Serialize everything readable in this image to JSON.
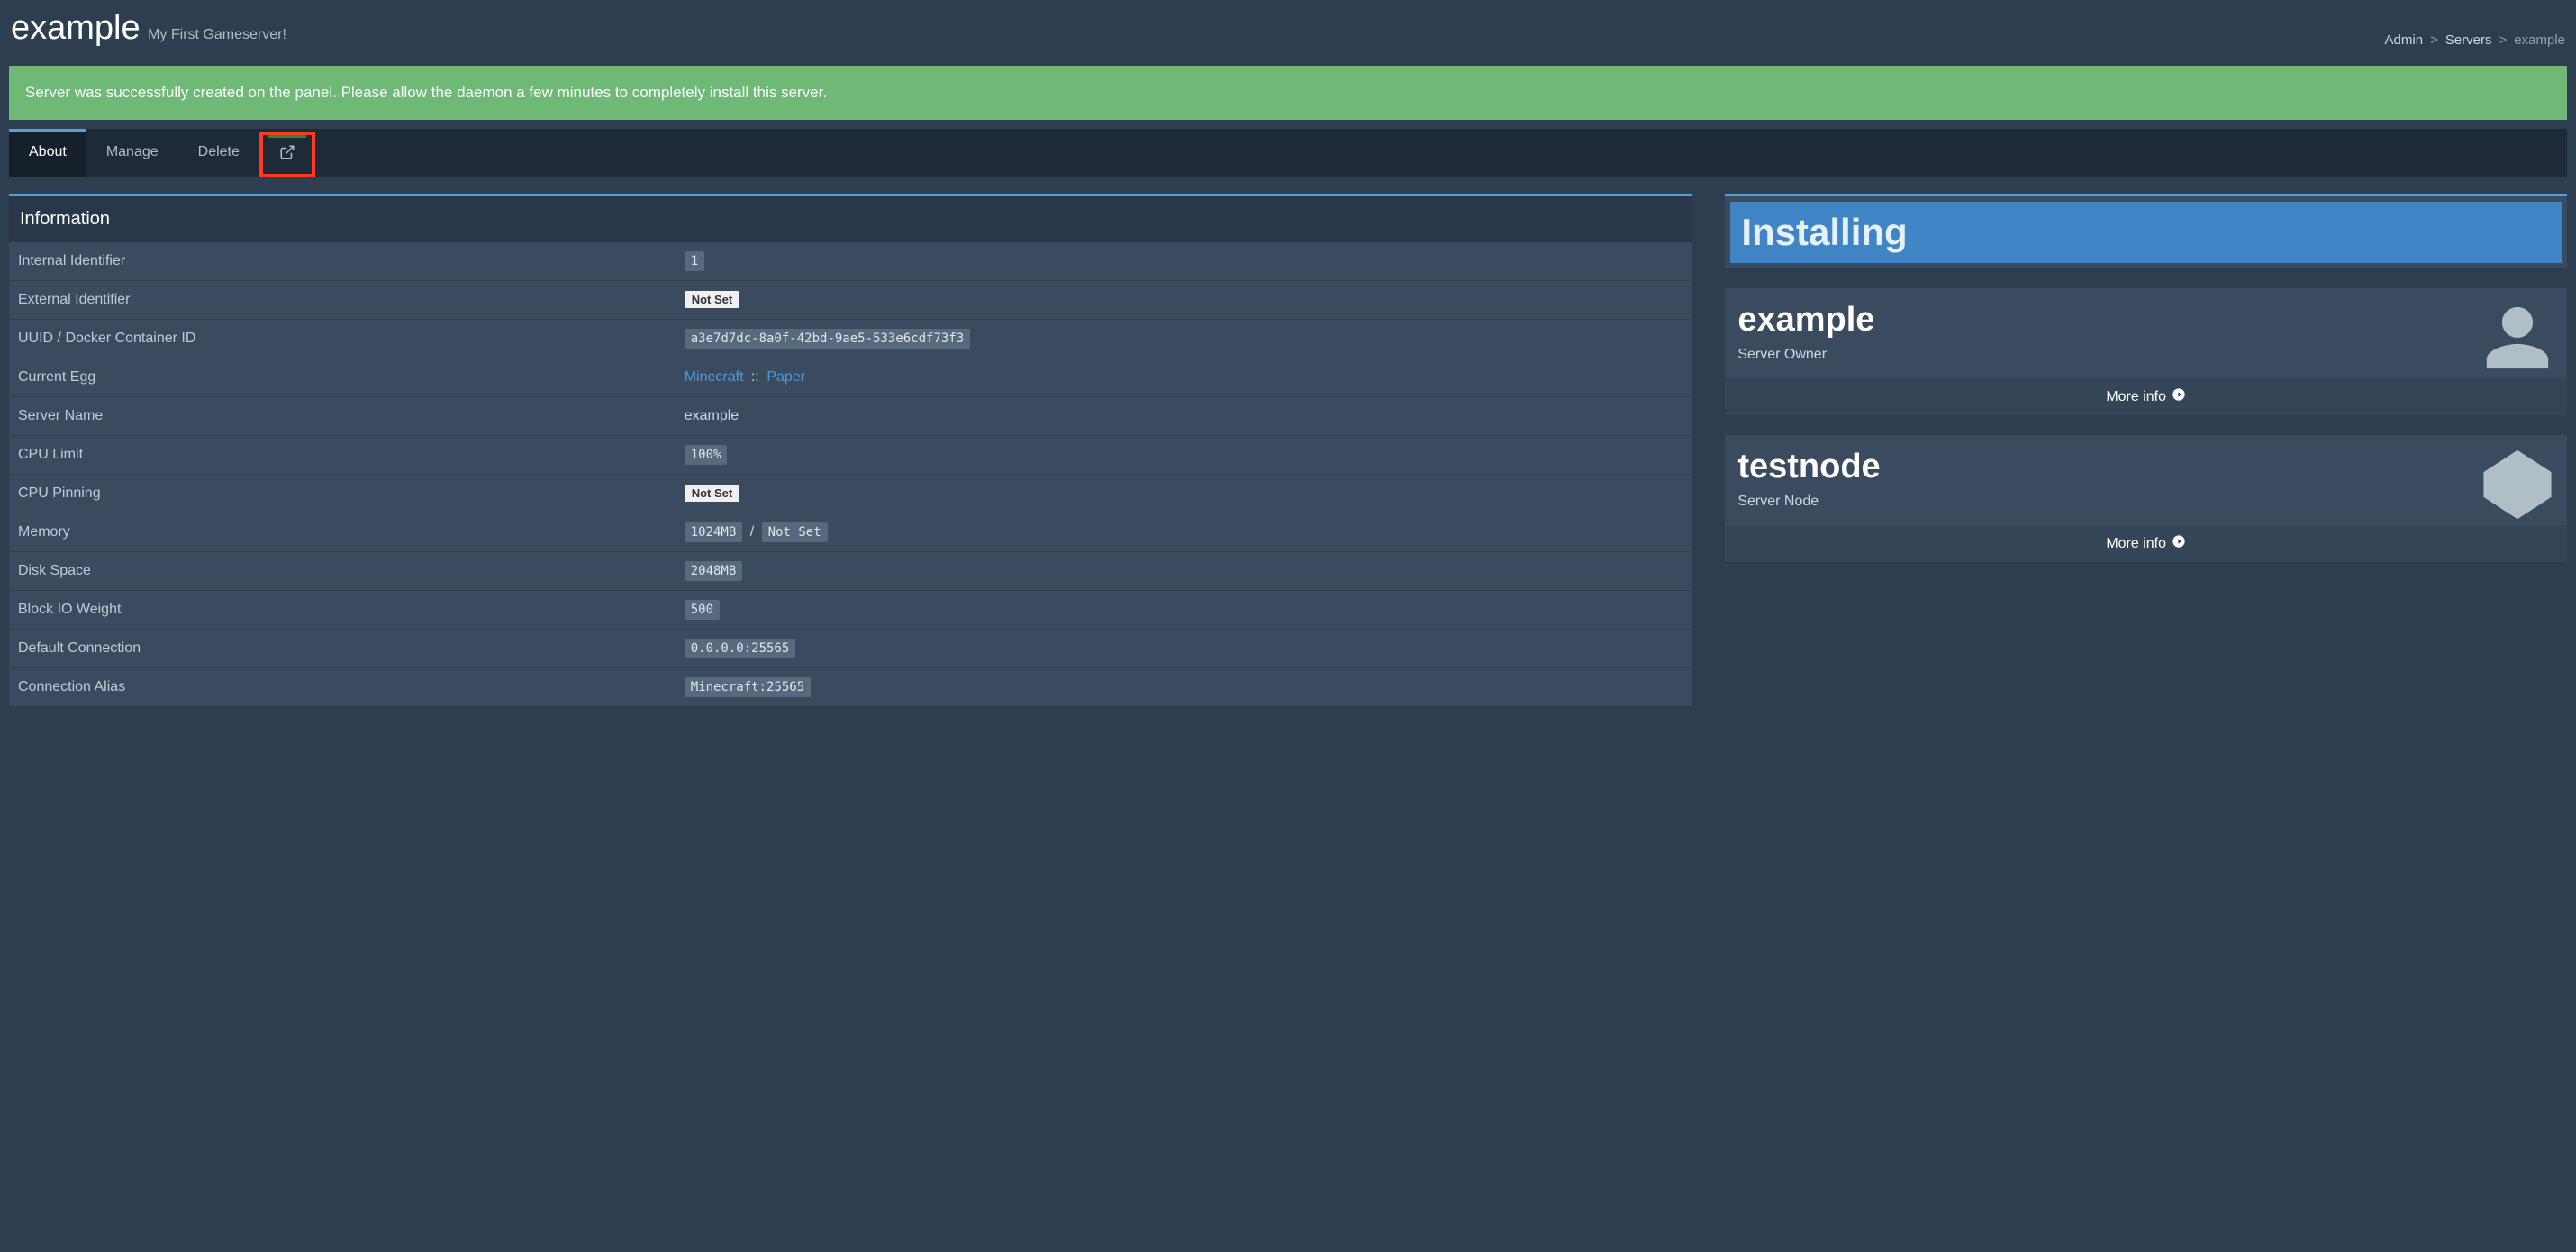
{
  "header": {
    "title": "example",
    "subtitle": "My First Gameserver!"
  },
  "breadcrumb": {
    "admin": "Admin",
    "servers": "Servers",
    "current": "example"
  },
  "alert": "Server was successfully created on the panel. Please allow the daemon a few minutes to completely install this server.",
  "tabs": {
    "about": "About",
    "manage": "Manage",
    "delete": "Delete"
  },
  "info": {
    "heading": "Information",
    "rows": {
      "internal_id": {
        "label": "Internal Identifier",
        "value": "1"
      },
      "external_id": {
        "label": "External Identifier",
        "value": "Not Set"
      },
      "uuid": {
        "label": "UUID / Docker Container ID",
        "value": "a3e7d7dc-8a0f-42bd-9ae5-533e6cdf73f3"
      },
      "egg": {
        "label": "Current Egg",
        "nest": "Minecraft",
        "egg": "Paper",
        "sep": "::"
      },
      "name": {
        "label": "Server Name",
        "value": "example"
      },
      "cpu_limit": {
        "label": "CPU Limit",
        "value": "100%"
      },
      "cpu_pinning": {
        "label": "CPU Pinning",
        "value": "Not Set"
      },
      "memory": {
        "label": "Memory",
        "value": "1024MB",
        "swap": "Not Set",
        "slash": "/"
      },
      "disk": {
        "label": "Disk Space",
        "value": "2048MB"
      },
      "block_io": {
        "label": "Block IO Weight",
        "value": "500"
      },
      "default_conn": {
        "label": "Default Connection",
        "value": "0.0.0.0:25565"
      },
      "conn_alias": {
        "label": "Connection Alias",
        "value": "Minecraft:25565"
      }
    }
  },
  "status": "Installing",
  "owner_card": {
    "title": "example",
    "subtitle": "Server Owner",
    "more": "More info"
  },
  "node_card": {
    "title": "testnode",
    "subtitle": "Server Node",
    "more": "More info"
  }
}
